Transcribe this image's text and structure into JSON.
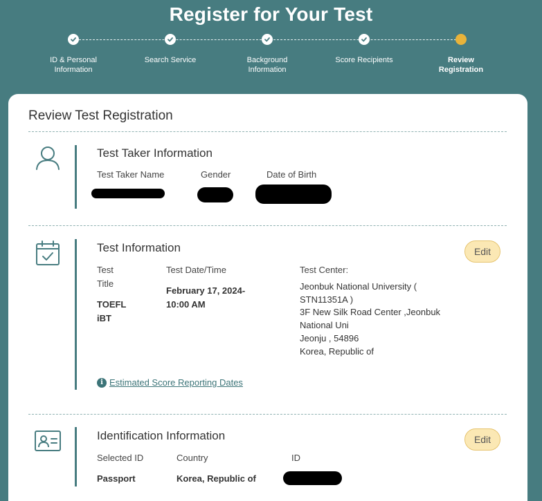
{
  "header": {
    "title": "Register for Your Test"
  },
  "colors": {
    "background": "#477c80",
    "step_done": "#ffffff",
    "step_current": "#e9b33a",
    "edit_button": "#fbe8b4",
    "accent": "#3c7478"
  },
  "stepper": {
    "steps": [
      {
        "line1": "ID & Personal",
        "line2": "Information",
        "status": "complete"
      },
      {
        "line1": "Search Service",
        "line2": "",
        "status": "complete"
      },
      {
        "line1": "Background",
        "line2": "Information",
        "status": "complete"
      },
      {
        "line1": "Score Recipients",
        "line2": "",
        "status": "complete"
      },
      {
        "line1": "Review",
        "line2": "Registration",
        "status": "current"
      }
    ]
  },
  "card": {
    "title": "Review Test Registration"
  },
  "test_taker": {
    "icon": "user-icon",
    "title": "Test Taker Information",
    "name_label": "Test Taker Name",
    "gender_label": "Gender",
    "dob_label": "Date of Birth"
  },
  "test_info": {
    "icon": "calendar-check-icon",
    "title": "Test Information",
    "edit_label": "Edit",
    "test_title_label_1": "Test",
    "test_title_label_2": "Title",
    "test_title_value_1": "TOEFL",
    "test_title_value_2": "iBT",
    "date_label": "Test Date/Time",
    "date_value_1": "February 17, 2024-",
    "date_value_2": "10:00 AM",
    "center_label": "Test Center:",
    "center_lines": [
      "Jeonbuk National University (",
      "STN11351A )",
      "3F New Silk Road Center ,Jeonbuk",
      "National Uni",
      "Jeonju , 54896",
      "Korea, Republic of"
    ],
    "score_dates_link": "Estimated Score Reporting Dates"
  },
  "identification": {
    "icon": "id-card-icon",
    "title": "Identification Information",
    "edit_label": "Edit",
    "selected_id_label": "Selected ID",
    "selected_id_value": "Passport",
    "country_label": "Country",
    "country_value": "Korea, Republic of",
    "id_label": "ID"
  }
}
